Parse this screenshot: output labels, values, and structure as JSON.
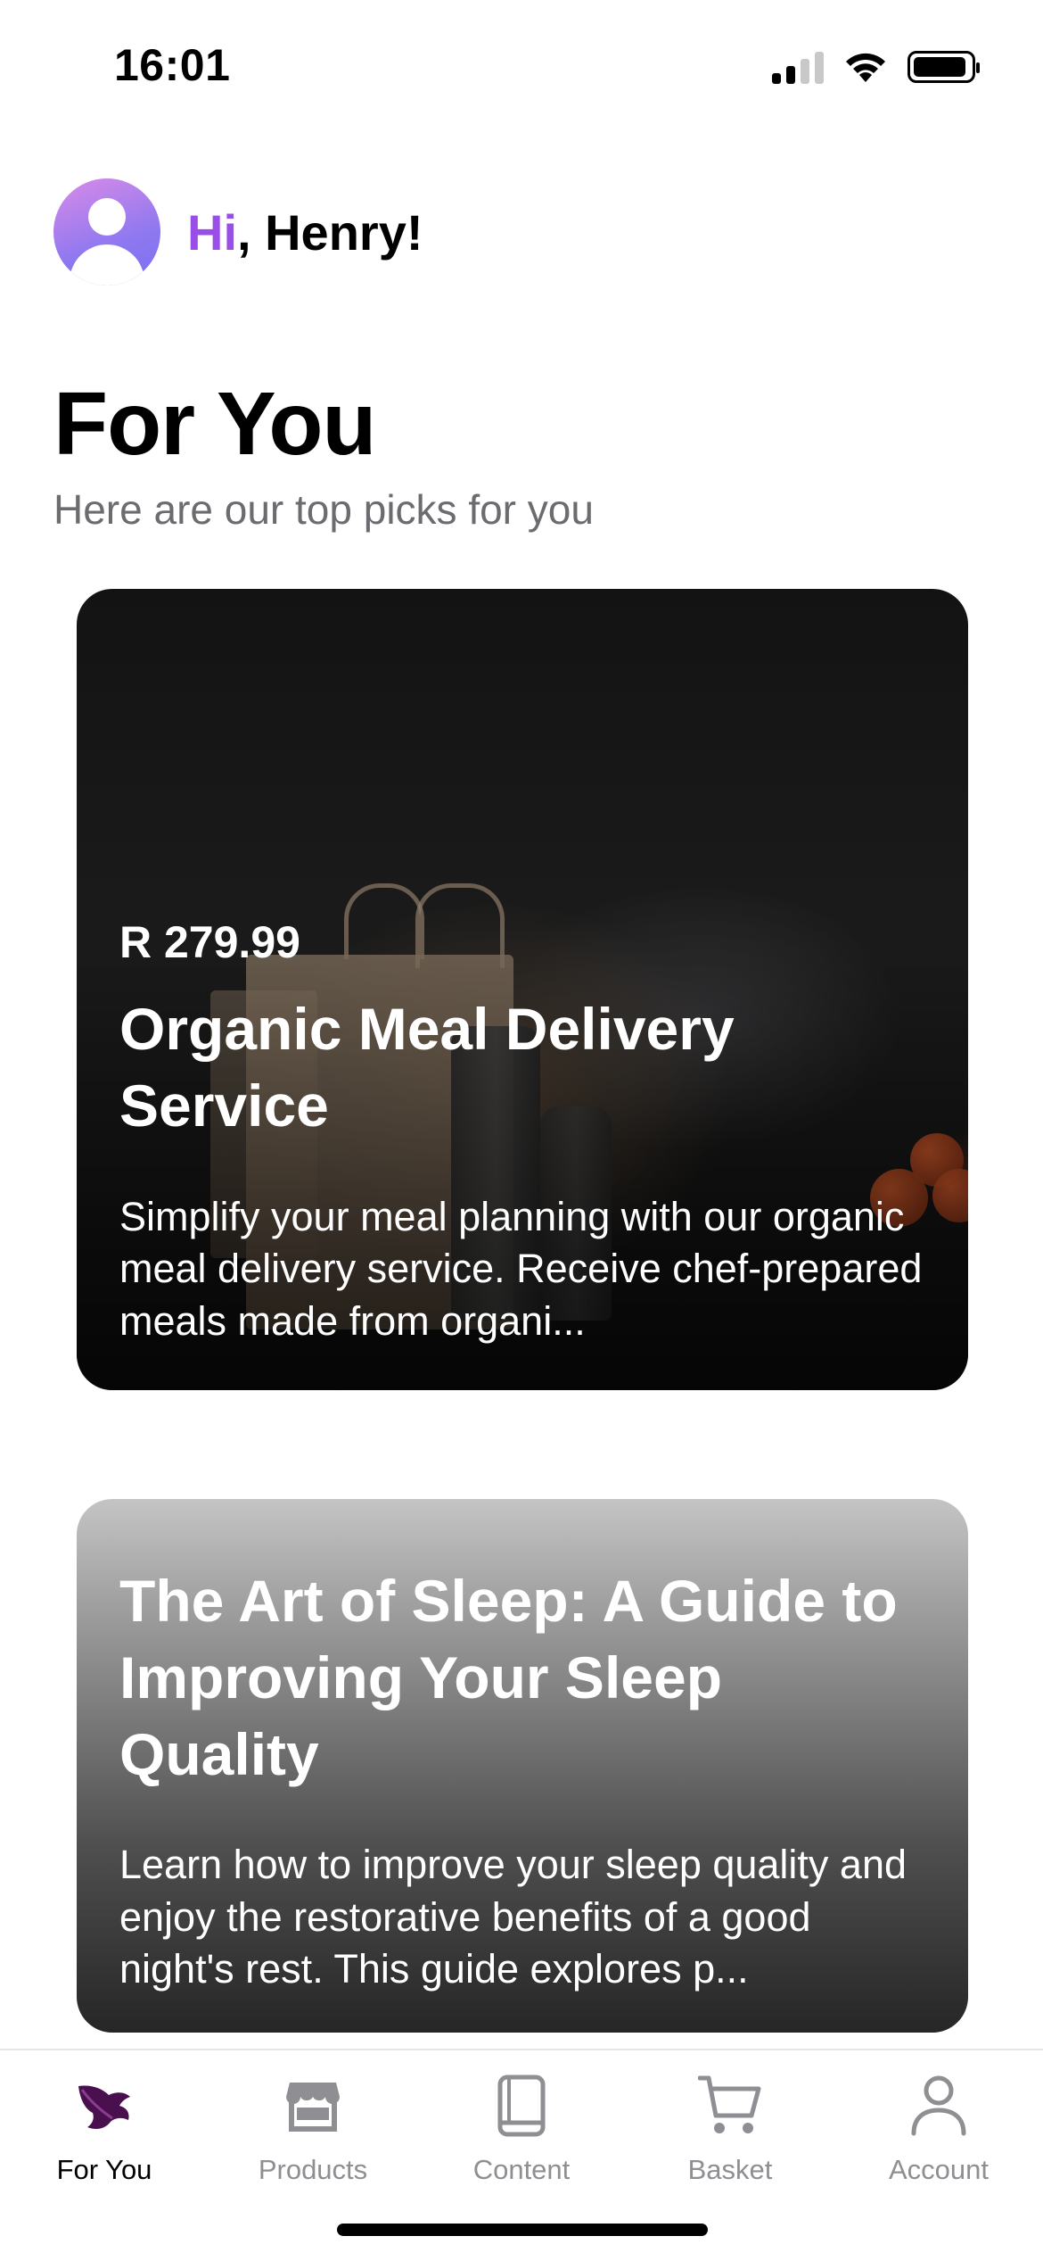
{
  "status_bar": {
    "time": "16:01"
  },
  "greeting": {
    "hi": "Hi",
    "name": ", Henry!"
  },
  "header": {
    "title": "For You",
    "subtitle": "Here are our top picks for you"
  },
  "cards": [
    {
      "price": "R 279.99",
      "title": "Organic Meal Delivery Service",
      "description": "Simplify your meal planning with our organic meal delivery service. Receive chef-prepared meals made from organi..."
    },
    {
      "title": "The Art of Sleep:  A Guide to Improving Your Sleep Quality",
      "description": "Learn how to improve your sleep quality and enjoy the restorative benefits of a good night's rest. This guide explores p..."
    }
  ],
  "tabs": [
    {
      "label": "For You",
      "icon": "leaf-logo-icon",
      "active": true
    },
    {
      "label": "Products",
      "icon": "store-icon",
      "active": false
    },
    {
      "label": "Content",
      "icon": "book-icon",
      "active": false
    },
    {
      "label": "Basket",
      "icon": "cart-icon",
      "active": false
    },
    {
      "label": "Account",
      "icon": "person-icon",
      "active": false
    }
  ],
  "colors": {
    "accent": "#9a4ee8",
    "active_icon": "#4a0f4f",
    "inactive": "#8e8e93"
  }
}
